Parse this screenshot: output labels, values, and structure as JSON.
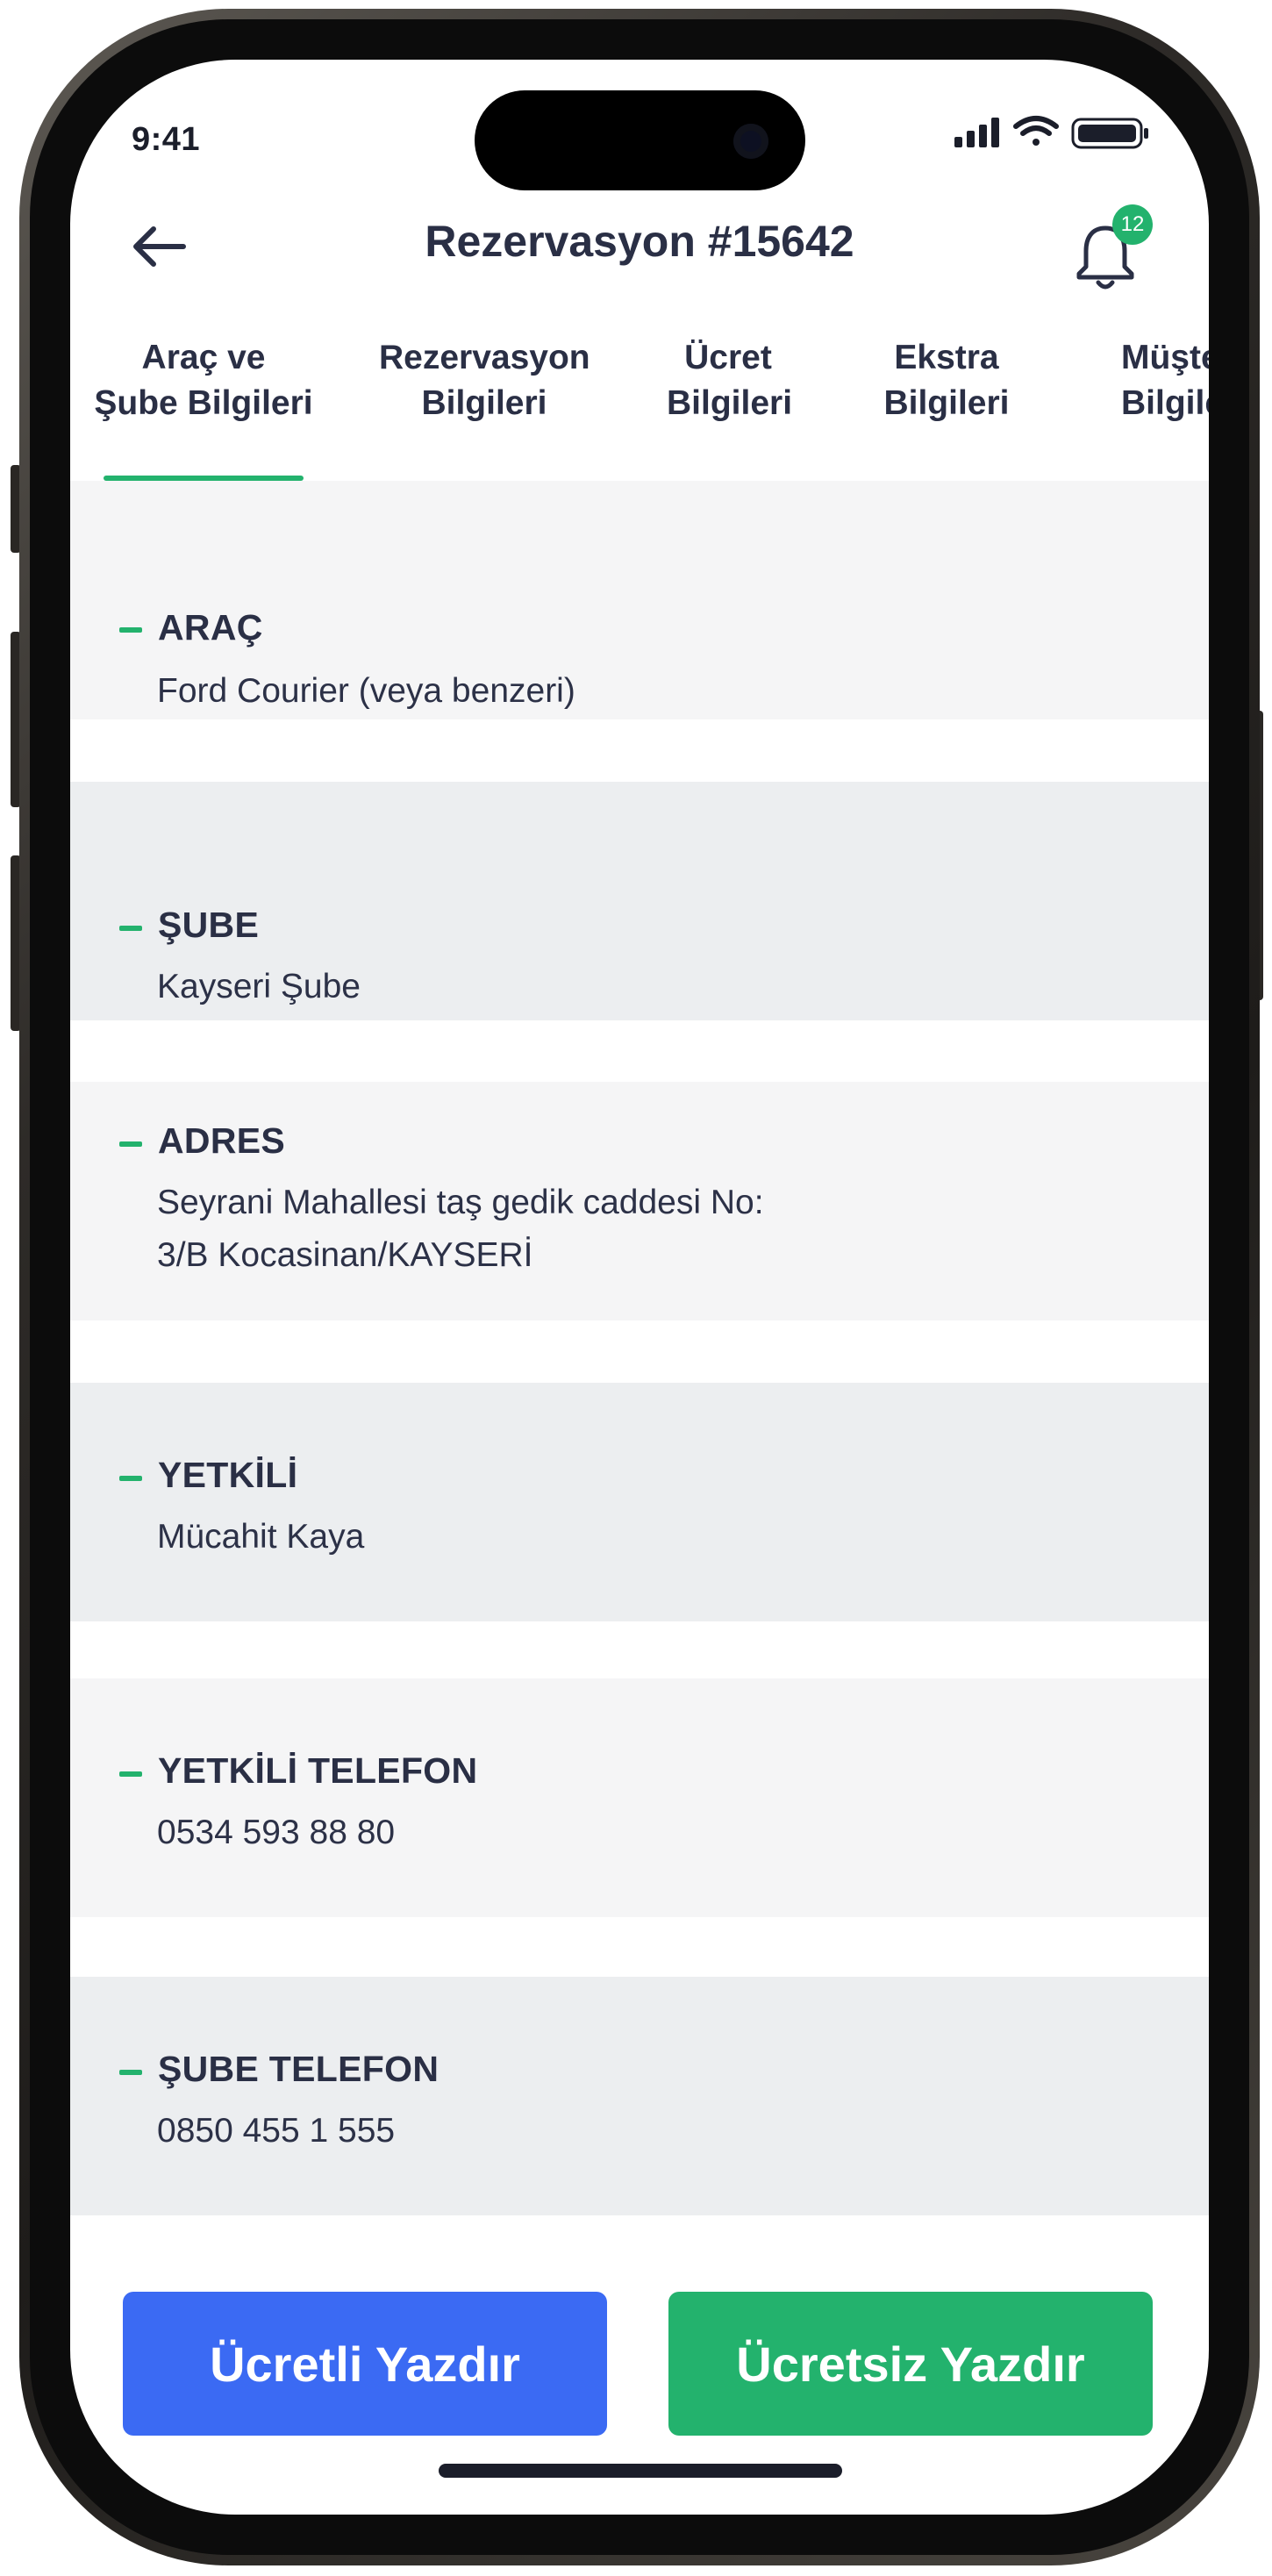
{
  "status_bar": {
    "time": "9:41"
  },
  "header": {
    "title": "Rezervasyon #15642",
    "back_icon": "arrow-left-icon",
    "notification_icon": "bell-icon",
    "notification_count": "12"
  },
  "tabs": [
    {
      "line1": "Araç ve",
      "line2": "Şube Bilgileri",
      "active": true
    },
    {
      "line1": "Rezervasyon",
      "line2": "Bilgileri",
      "active": false
    },
    {
      "line1": "Ücret",
      "line2": "Bilgileri",
      "active": false
    },
    {
      "line1": "Ekstra",
      "line2": "Bilgileri",
      "active": false
    },
    {
      "line1": "Müşteri",
      "line2": "Bilgileri",
      "active": false
    }
  ],
  "sections": [
    {
      "label": "ARAÇ",
      "value": "Ford Courier (veya benzeri)"
    },
    {
      "label": "ŞUBE",
      "value": "Kayseri Şube"
    },
    {
      "label": "ADRES",
      "value_line1": "Seyrani Mahallesi taş gedik caddesi No:",
      "value_line2": "3/B Kocasinan/KAYSERİ"
    },
    {
      "label": "YETKİLİ",
      "value": "Mücahit Kaya"
    },
    {
      "label": "YETKİLİ TELEFON",
      "value": "0534 593 88 80"
    },
    {
      "label": "ŞUBE TELEFON",
      "value": "0850 455 1 555"
    }
  ],
  "actions": {
    "paid_print": "Ücretli Yazdır",
    "free_print": "Ücretsiz Yazdır"
  },
  "colors": {
    "accent_green": "#23b26d",
    "primary_blue": "#3b6af3",
    "text_dark": "#2a2f45",
    "section_bg_light": "#f5f5f6",
    "section_bg_dark": "#eceef0"
  }
}
